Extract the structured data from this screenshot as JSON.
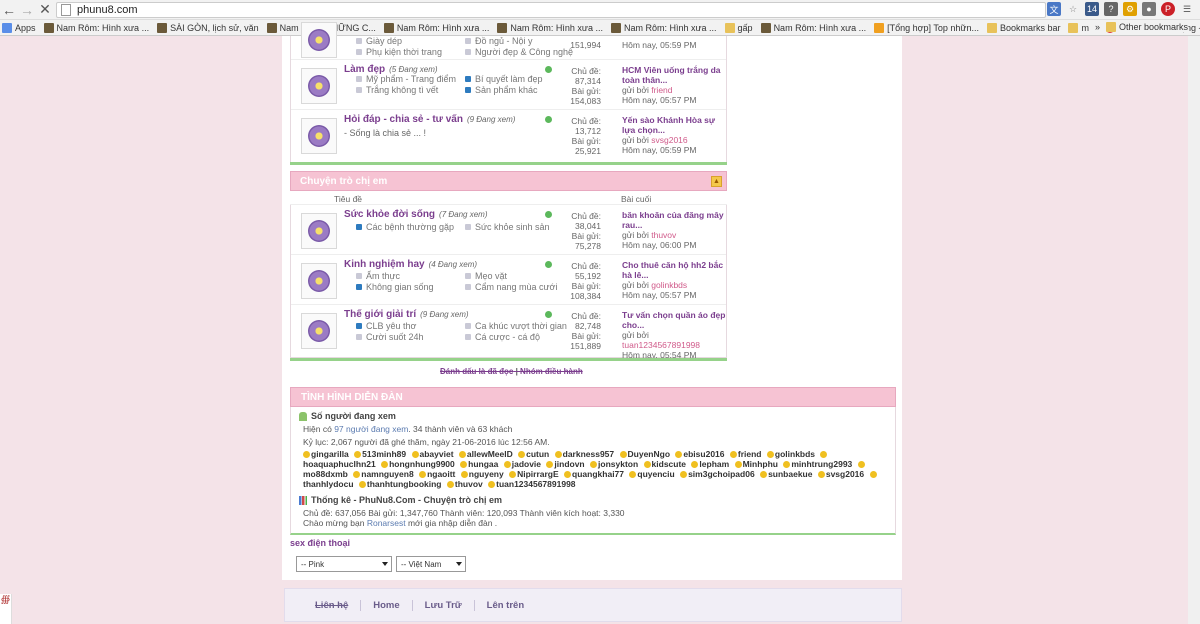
{
  "browser": {
    "url": "phunu8.com",
    "badge_count": "14",
    "extensions": [
      "translate-icon",
      "star-icon",
      "badge-14-icon",
      "help-icon",
      "extension-gear-icon",
      "lock-extension-icon",
      "pinterest-icon",
      "menu-icon"
    ]
  },
  "bookmarks": [
    {
      "label": "Apps",
      "icon": "apps-icon"
    },
    {
      "label": "Nam Rôm: Hình xưa ...",
      "icon": "page-icon"
    },
    {
      "label": "SÀI GÒN, lịch sử, văn",
      "icon": "page-icon"
    },
    {
      "label": "Nam Rôm: NHỮNG C...",
      "icon": "page-icon"
    },
    {
      "label": "Nam Rôm: Hình xưa ...",
      "icon": "page-icon"
    },
    {
      "label": "Nam Rôm: Hình xưa ...",
      "icon": "page-icon"
    },
    {
      "label": "Nam Rôm: Hình xưa ...",
      "icon": "page-icon"
    },
    {
      "label": "gấp",
      "icon": "folder-icon"
    },
    {
      "label": "Nam Rôm: Hình xưa ...",
      "icon": "page-icon"
    },
    {
      "label": "[Tổng hợp] Top nhữn...",
      "icon": "page-icon"
    },
    {
      "label": "Bookmarks bar",
      "icon": "folder-icon"
    },
    {
      "label": "mới",
      "icon": "folder-icon"
    },
    {
      "label": "Trò chơi hành động -",
      "icon": "page-icon"
    }
  ],
  "bookmarks_other": "Other bookmarks",
  "top_rows": [
    {
      "sub": [
        [
          "Giày dép",
          "Đồ ngủ - Nội y"
        ],
        [
          "Phụ kiện thời trang",
          "Người đẹp & Công nghệ"
        ]
      ],
      "stats": [
        "151,994"
      ],
      "last_time": "Hôm nay, 05:59 PM"
    },
    {
      "title": "Làm đẹp",
      "viewing": "(5 Đang xem)",
      "sub": [
        [
          "Mỹ phẩm - Trang điểm",
          "Bí quyết làm đẹp"
        ],
        [
          "Trắng không tì vết",
          "Sản phẩm khác"
        ]
      ],
      "stats_labels": [
        "Chủ đề:",
        "Bài gửi:"
      ],
      "stats": [
        "87,314",
        "154,083"
      ],
      "last_title": "HCM Viên uống trắng da toàn thân...",
      "last_by": "gửi bởi",
      "last_user": "friend",
      "last_time": "Hôm nay, 05:57 PM"
    },
    {
      "title": "Hỏi đáp - chia sẻ - tư vấn",
      "viewing": "(9 Đang xem)",
      "desc": "- Sống là chia sẻ ... !",
      "stats_labels": [
        "Chủ đề:",
        "Bài gửi:"
      ],
      "stats": [
        "13,712",
        "25,921"
      ],
      "last_title": "Yến sào Khánh Hòa sự lựa chọn...",
      "last_by": "gửi bởi",
      "last_user": "svsg2016",
      "last_time": "Hôm nay, 05:59 PM"
    }
  ],
  "category": {
    "title": "Chuyện trò chị em",
    "col_topic": "Tiêu đề",
    "col_last": "Bài cuối",
    "rows": [
      {
        "title": "Sức khỏe đời sống",
        "viewing": "(7 Đang xem)",
        "sub": [
          [
            "Các bệnh thường gặp",
            "Sức khỏe sinh sản"
          ]
        ],
        "stats_labels": [
          "Chủ đề:",
          "Bài gửi:"
        ],
        "stats": [
          "38,041",
          "75,278"
        ],
        "last_title": "băn khoăn của đăng mây rau...",
        "last_by": "gửi bởi",
        "last_user": "thuvov",
        "last_time": "Hôm nay, 06:00 PM"
      },
      {
        "title": "Kinh nghiệm hay",
        "viewing": "(4 Đang xem)",
        "sub": [
          [
            "Ẩm thực",
            "Mẹo vặt"
          ],
          [
            "Không gian sống",
            "Cẩm nang mùa cưới"
          ]
        ],
        "stats_labels": [
          "Chủ đề:",
          "Bài gửi:"
        ],
        "stats": [
          "55,192",
          "108,384"
        ],
        "last_title": "Cho thuê căn hộ hh2 bắc hà lê...",
        "last_by": "gửi bởi",
        "last_user": "golinkbds",
        "last_time": "Hôm nay, 05:57 PM"
      },
      {
        "title": "Thế giới giải trí",
        "viewing": "(9 Đang xem)",
        "sub": [
          [
            "CLB yêu thơ",
            "Ca khúc vượt thời gian"
          ],
          [
            "Cười suốt 24h",
            "Cá cược - cá độ"
          ]
        ],
        "stats_labels": [
          "Chủ đề:",
          "Bài gửi:"
        ],
        "stats": [
          "82,748",
          "151,889"
        ],
        "last_title": "Tư vấn chọn quần áo đẹp cho...",
        "last_by": "gửi bởi",
        "last_user": "tuan1234567891998",
        "last_time": "Hôm nay, 05:54 PM"
      }
    ]
  },
  "mark_read": "Đánh dấu là đã đọc",
  "leaders": "Nhóm điều hành",
  "status": {
    "title": "TÌNH HÌNH DIỄN ĐÀN",
    "online_title": "Số người đang xem",
    "online_prefix": "Hiện có",
    "online_count": "97 người đang xem",
    "online_detail": ". 34 thành viên và 63 khách",
    "record": "Kỷ lục: 2,067 người đã ghé thăm, ngày 21-06-2016 lúc 12:56 AM.",
    "users": [
      "gingarilla",
      "513minh89",
      "abayviet",
      "allewMeelD",
      "cutun",
      "darkness957",
      "DuyenNgo",
      "ebisu2016",
      "friend",
      "golinkbds",
      "hoaquaphuclhn21",
      "hongnhung9900",
      "hungaa",
      "jadovie",
      "jindovn",
      "jonsykton",
      "kidscute",
      "lepham",
      "Minhphu",
      "minhtrung2993",
      "mo88dxmb",
      "namnguyen8",
      "ngaoitt",
      "nguyeny",
      "NipirrargE",
      "quangkhai77",
      "quyenciu",
      "sim3gchoipad06",
      "sunbaekue",
      "svsg2016",
      "thanhlydocu",
      "thanhtungbooking",
      "thuvov",
      "tuan1234567891998"
    ],
    "stats_title": "Thống kê - PhuNu8.Com - Chuyện trò chị em",
    "stats_line": "Chủ đề: 637,056   Bài gửi: 1,347,760   Thành viên: 120,093   Thành viên kích hoạt: 3,330",
    "welcome_prefix": "Chào mừng bạn",
    "welcome_user": "Ronarsest",
    "welcome_suffix": "mới gia nhập diễn đàn ."
  },
  "sex_link": "sex điện thoại",
  "style_select": "-- Pink",
  "lang_select": "-- Việt Nam",
  "footer": [
    "Liên hệ",
    "Home",
    "Lưu Trữ",
    "Lên trên"
  ]
}
